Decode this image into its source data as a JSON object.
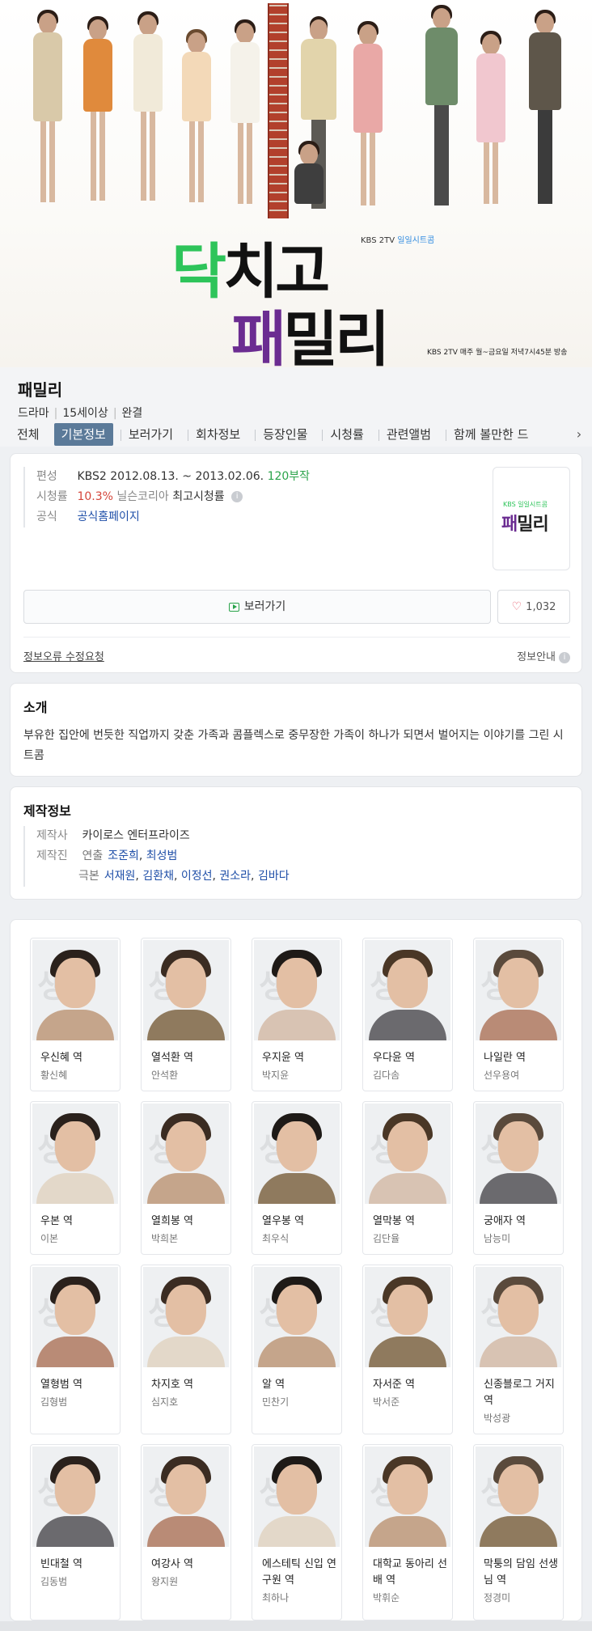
{
  "hero": {
    "title_line1_accent": "닥",
    "title_line1_rest": "치고",
    "title_line2_accent": "패",
    "title_line2_rest": "밀리",
    "channel_prefix": "KBS 2TV",
    "channel_tag": "일일시트콤",
    "broadcast_note": "KBS 2TV 매주 월~금요일 저녁7시45분 방송"
  },
  "header": {
    "title": "패밀리",
    "meta": [
      "드라마",
      "15세이상",
      "완결"
    ]
  },
  "tabs": [
    {
      "label": "전체",
      "active": false
    },
    {
      "label": "기본정보",
      "active": true
    },
    {
      "label": "보러가기",
      "active": false
    },
    {
      "label": "회차정보",
      "active": false
    },
    {
      "label": "등장인물",
      "active": false
    },
    {
      "label": "시청률",
      "active": false
    },
    {
      "label": "관련앨범",
      "active": false
    },
    {
      "label": "함께 볼만한 드",
      "active": false
    }
  ],
  "info": {
    "broadcast_label": "편성",
    "broadcast_channel": "KBS2",
    "broadcast_period": "2012.08.13. ~ 2013.02.06.",
    "episodes": "120부작",
    "rating_label": "시청률",
    "rating_value": "10.3%",
    "rating_source": "닐슨코리아",
    "rating_type": "최고시청률",
    "official_label": "공식",
    "official_link": "공식홈페이지",
    "poster_sub": "KBS 일일시트콤",
    "poster_accent": "패",
    "poster_rest": "밀리",
    "watch_button": "보러가기",
    "like_count": "1,032",
    "report_link": "정보오류 수정요청",
    "info_guide": "정보안내"
  },
  "intro": {
    "title": "소개",
    "text": "부유한 집안에 번듯한 직업까지 갖춘 가족과 콤플렉스로 중무장한 가족이 하나가 되면서 벌어지는 이야기를 그린 시트콤"
  },
  "production": {
    "title": "제작정보",
    "company_label": "제작사",
    "company": "카이로스 엔터프라이즈",
    "staff_label": "제작진",
    "director_label": "연출",
    "directors": [
      "조준희",
      "최성범"
    ],
    "writer_label": "극본",
    "writers": [
      "서재원",
      "김환채",
      "이정선",
      "권소라",
      "김바다"
    ]
  },
  "cast": [
    {
      "role": "우신혜 역",
      "actor": "황신혜"
    },
    {
      "role": "열석환 역",
      "actor": "안석환"
    },
    {
      "role": "우지윤 역",
      "actor": "박지윤"
    },
    {
      "role": "우다윤 역",
      "actor": "김다솜"
    },
    {
      "role": "나일란 역",
      "actor": "선우용여"
    },
    {
      "role": "우본 역",
      "actor": "이본"
    },
    {
      "role": "열희봉 역",
      "actor": "박희본"
    },
    {
      "role": "열우봉 역",
      "actor": "최우식"
    },
    {
      "role": "열막봉 역",
      "actor": "김단율"
    },
    {
      "role": "궁애자 역",
      "actor": "남능미"
    },
    {
      "role": "열형범 역",
      "actor": "김형범"
    },
    {
      "role": "차지호 역",
      "actor": "심지호"
    },
    {
      "role": "알 역",
      "actor": "민찬기"
    },
    {
      "role": "자서준 역",
      "actor": "박서준"
    },
    {
      "role": "신종블로그 거지 역",
      "actor": "박성광"
    },
    {
      "role": "빈대철 역",
      "actor": "김동범"
    },
    {
      "role": "여강사 역",
      "actor": "왕지원"
    },
    {
      "role": "에스테틱 신입 연구원 역",
      "actor": "최하나"
    },
    {
      "role": "대학교 동아리 선배 역",
      "actor": "박휘순"
    },
    {
      "role": "막퉁의 담임 선생님 역",
      "actor": "정경미"
    }
  ],
  "cast_photo_watermark": "생가",
  "colors": {
    "accent_green": "#2aa34a",
    "rating_red": "#d4453a",
    "link_blue": "#1f4fa8",
    "active_tab": "#5b7a99"
  }
}
